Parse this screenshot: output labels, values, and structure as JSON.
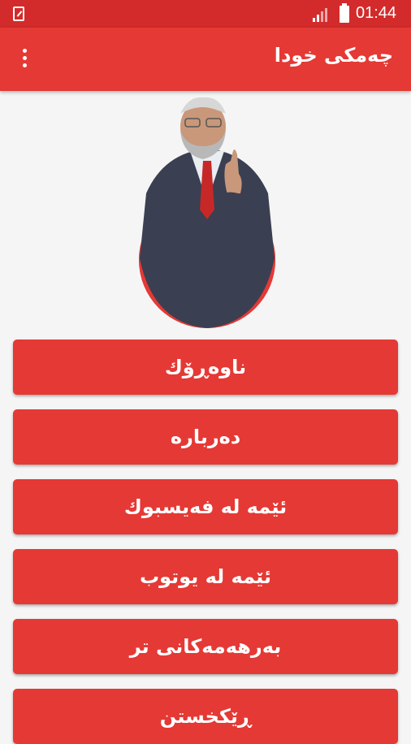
{
  "status_bar": {
    "time": "01:44",
    "icons": [
      "image-notification-icon",
      "signal-icon",
      "battery-icon"
    ]
  },
  "app_bar": {
    "title": "چەمکی خودا",
    "menu_icon": "overflow-menu-icon"
  },
  "hero": {
    "image": "speaker-portrait"
  },
  "menu": {
    "items": [
      {
        "label": "ناوەڕۆك"
      },
      {
        "label": "دەربارە"
      },
      {
        "label": "ئێمە لە فەیسبوك"
      },
      {
        "label": "ئێمە لە یوتوب"
      },
      {
        "label": "بەرهەمەكانی تر"
      },
      {
        "label": "ڕێكخستن"
      }
    ]
  },
  "colors": {
    "primary": "#e53935",
    "status_bar": "#d32b2b",
    "background": "#f5f5f5",
    "text_on_primary": "#ffffff"
  }
}
